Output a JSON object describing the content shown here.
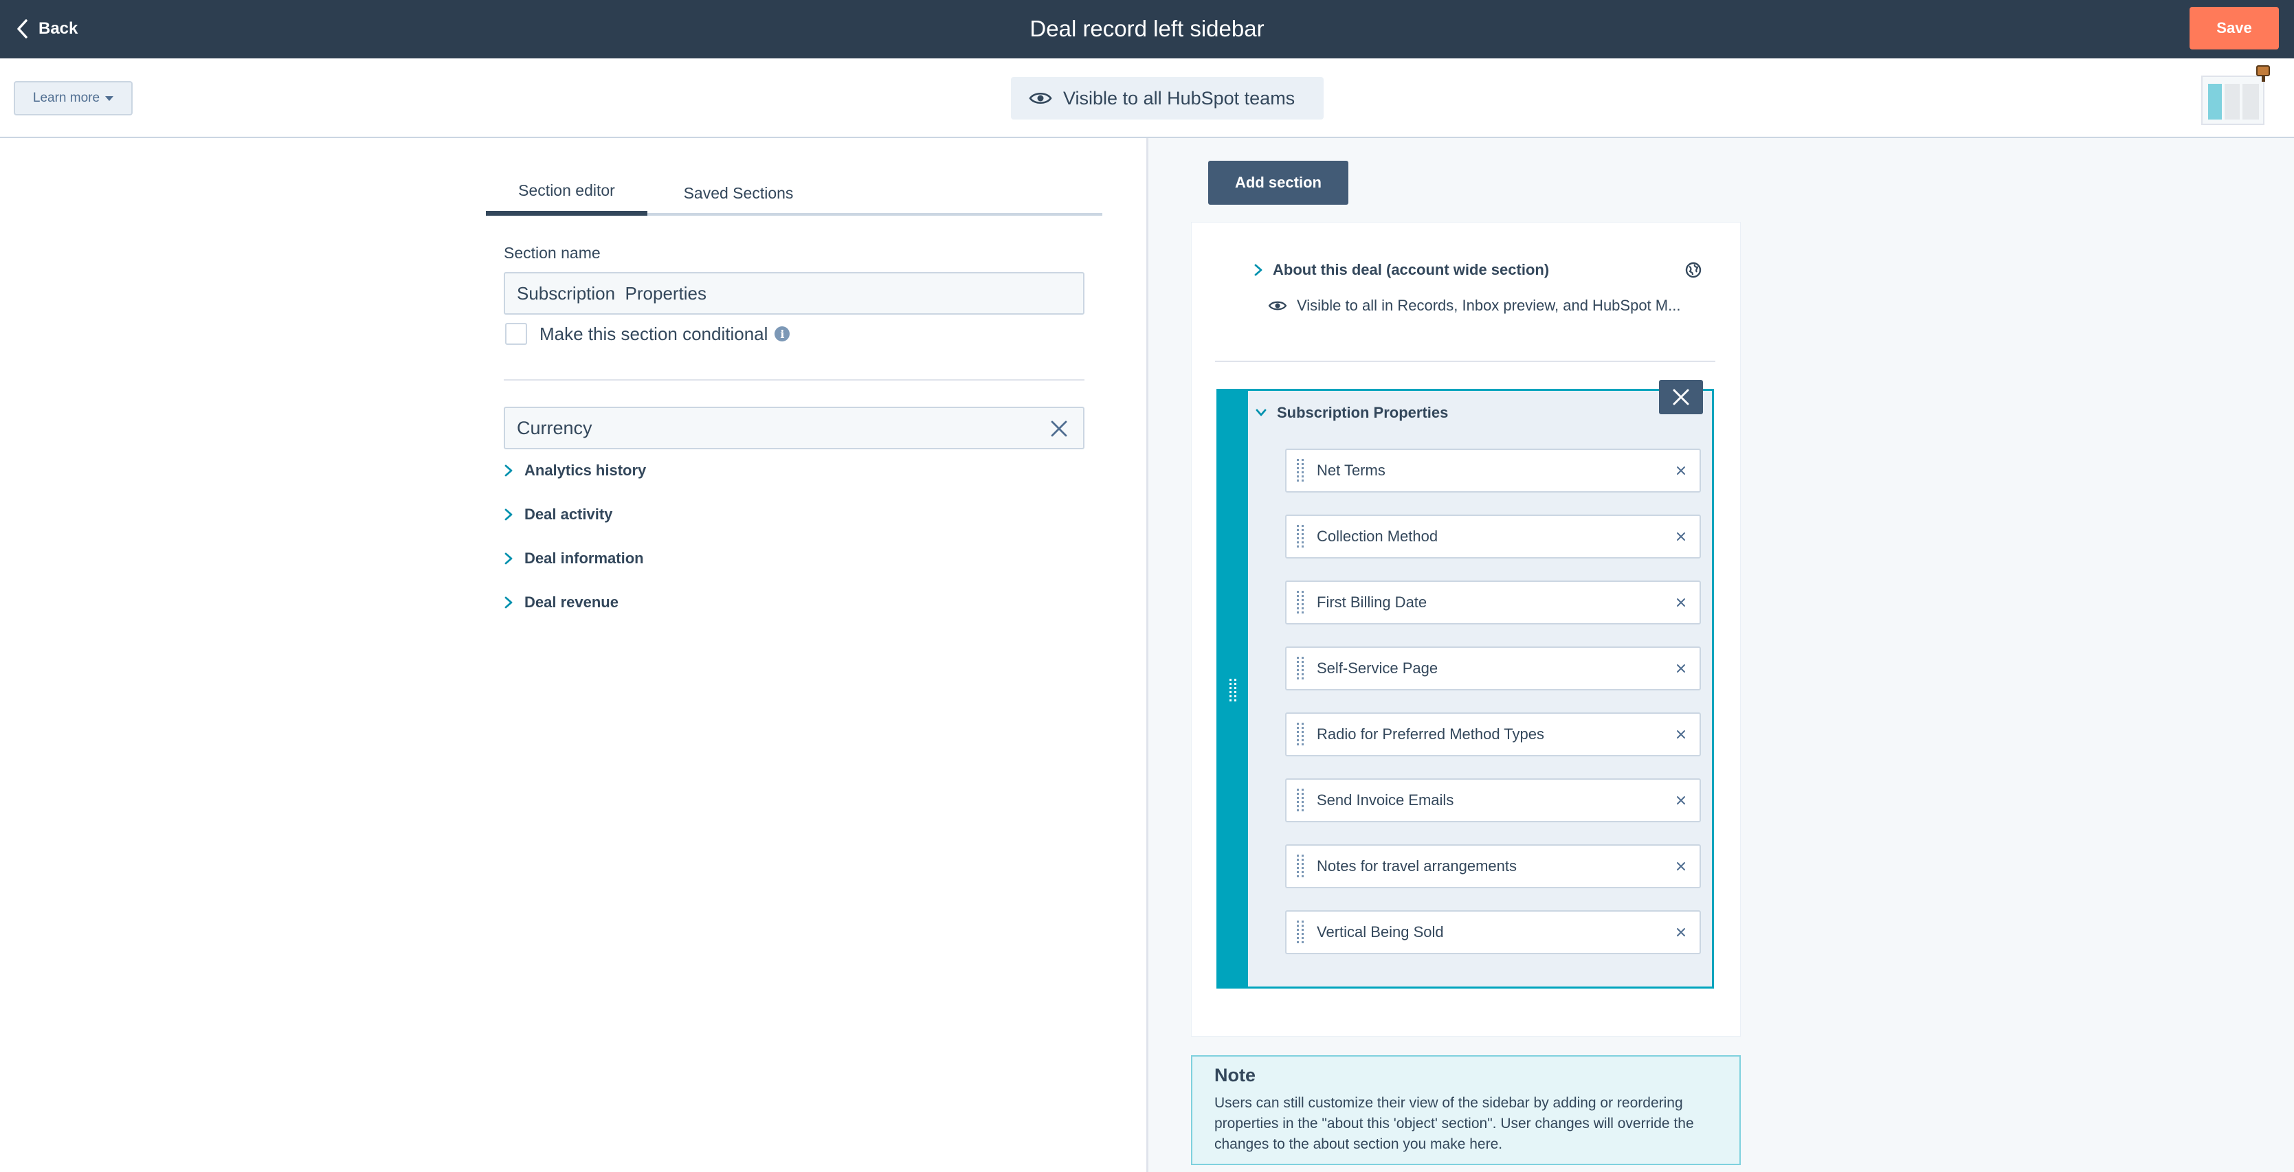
{
  "header": {
    "back_label": "Back",
    "title": "Deal record left sidebar",
    "save_label": "Save"
  },
  "subbar": {
    "learn_more_label": "Learn more",
    "visibility_label": "Visible to all HubSpot teams"
  },
  "tabs": [
    {
      "label": "Section editor",
      "active": true
    },
    {
      "label": "Saved Sections",
      "active": false
    }
  ],
  "editor": {
    "section_name_label": "Section name",
    "section_name_value": "Subscription  Properties",
    "conditional_label": "Make this section conditional",
    "search_value": "Currency",
    "groups": [
      {
        "label": "Analytics history"
      },
      {
        "label": "Deal activity"
      },
      {
        "label": "Deal information"
      },
      {
        "label": "Deal revenue"
      }
    ]
  },
  "preview": {
    "add_section_label": "Add section",
    "about_section": {
      "title": "About this deal (account wide section)",
      "visibility": "Visible to all in Records, Inbox preview, and HubSpot M..."
    },
    "editing_section": {
      "title": "Subscription Properties",
      "properties": [
        {
          "label": "Net Terms"
        },
        {
          "label": "Collection Method"
        },
        {
          "label": "First Billing Date"
        },
        {
          "label": "Self-Service Page"
        },
        {
          "label": "Radio for Preferred Method Types"
        },
        {
          "label": "Send Invoice Emails"
        },
        {
          "label": "Notes for travel arrangements"
        },
        {
          "label": "Vertical Being Sold"
        }
      ]
    }
  },
  "note": {
    "title": "Note",
    "text": "Users can still customize their view of the sidebar by adding or reordering properties in the \"about this 'object' section\". User changes will override the changes to the about section you make here."
  },
  "colors": {
    "header_bg": "#2d3e50",
    "save_button": "#ff7a59",
    "accent_teal": "#00a4bd",
    "dark_button": "#425b76"
  },
  "icons": [
    "chevron-left-icon",
    "eye-icon",
    "caret-down-icon",
    "info-icon",
    "clear-icon",
    "chevron-right-icon",
    "globe-icon",
    "close-icon",
    "drag-handle-icon",
    "remove-icon",
    "chevron-down-icon",
    "paint-icon"
  ]
}
